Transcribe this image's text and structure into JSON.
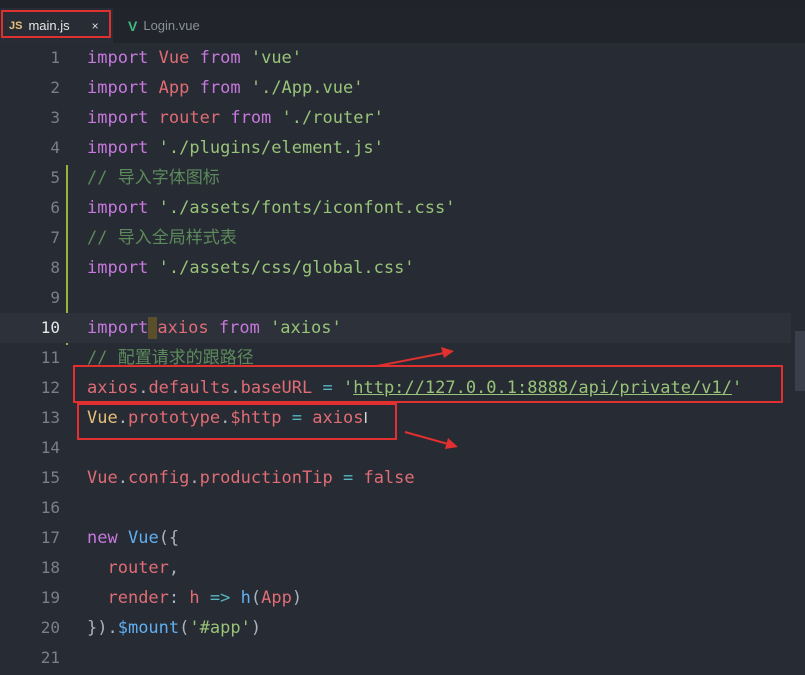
{
  "tabs": [
    {
      "icon": "JS",
      "label": "main.js",
      "close": "×",
      "active": true
    },
    {
      "icon": "V",
      "label": "Login.vue",
      "active": false
    }
  ],
  "lines": [
    {
      "n": "1",
      "tokens": [
        [
          "kw",
          "import"
        ],
        [
          "pl",
          " "
        ],
        [
          "id",
          "Vue"
        ],
        [
          "pl",
          " "
        ],
        [
          "kw",
          "from"
        ],
        [
          "pl",
          " "
        ],
        [
          "str",
          "'vue'"
        ]
      ]
    },
    {
      "n": "2",
      "tokens": [
        [
          "kw",
          "import"
        ],
        [
          "pl",
          " "
        ],
        [
          "id",
          "App"
        ],
        [
          "pl",
          " "
        ],
        [
          "kw",
          "from"
        ],
        [
          "pl",
          " "
        ],
        [
          "str",
          "'./App.vue'"
        ]
      ]
    },
    {
      "n": "3",
      "tokens": [
        [
          "kw",
          "import"
        ],
        [
          "pl",
          " "
        ],
        [
          "id",
          "router"
        ],
        [
          "pl",
          " "
        ],
        [
          "kw",
          "from"
        ],
        [
          "pl",
          " "
        ],
        [
          "str",
          "'./router'"
        ]
      ]
    },
    {
      "n": "4",
      "tokens": [
        [
          "kw",
          "import"
        ],
        [
          "pl",
          " "
        ],
        [
          "str",
          "'./plugins/element.js'"
        ]
      ]
    },
    {
      "n": "5",
      "tokens": [
        [
          "cm",
          "// 导入字体图标"
        ]
      ]
    },
    {
      "n": "6",
      "tokens": [
        [
          "kw",
          "import"
        ],
        [
          "pl",
          " "
        ],
        [
          "str",
          "'./assets/fonts/iconfont.css'"
        ]
      ]
    },
    {
      "n": "7",
      "tokens": [
        [
          "cm",
          "// 导入全局样式表"
        ]
      ]
    },
    {
      "n": "8",
      "tokens": [
        [
          "kw",
          "import"
        ],
        [
          "pl",
          " "
        ],
        [
          "str",
          "'./assets/css/global.css'"
        ]
      ]
    },
    {
      "n": "9",
      "tokens": []
    },
    {
      "n": "10",
      "tokens": [
        [
          "kw",
          "import"
        ],
        [
          "cursor",
          " "
        ],
        [
          "id",
          "axios"
        ],
        [
          "pl",
          " "
        ],
        [
          "kw",
          "from"
        ],
        [
          "pl",
          " "
        ],
        [
          "str",
          "'axios'"
        ]
      ]
    },
    {
      "n": "11",
      "tokens": [
        [
          "cm",
          "// 配置请求的跟路径"
        ]
      ]
    },
    {
      "n": "12",
      "tokens": [
        [
          "id",
          "axios"
        ],
        [
          "pl",
          "."
        ],
        [
          "id",
          "defaults"
        ],
        [
          "pl",
          "."
        ],
        [
          "id",
          "baseURL"
        ],
        [
          "pl",
          " "
        ],
        [
          "op",
          "="
        ],
        [
          "pl",
          " "
        ],
        [
          "str",
          "'"
        ],
        [
          "url",
          "http://127.0.0.1:8888/api/private/v1/"
        ],
        [
          "str",
          "'"
        ]
      ]
    },
    {
      "n": "13",
      "tokens": [
        [
          "prop",
          "Vue"
        ],
        [
          "pl",
          "."
        ],
        [
          "id",
          "prototype"
        ],
        [
          "pl",
          "."
        ],
        [
          "id",
          "$http"
        ],
        [
          "pl",
          " "
        ],
        [
          "op",
          "="
        ],
        [
          "pl",
          " "
        ],
        [
          "id",
          "axios"
        ],
        [
          "ibeam",
          "I"
        ]
      ]
    },
    {
      "n": "14",
      "tokens": []
    },
    {
      "n": "15",
      "tokens": [
        [
          "id",
          "Vue"
        ],
        [
          "pl",
          "."
        ],
        [
          "id",
          "config"
        ],
        [
          "pl",
          "."
        ],
        [
          "id",
          "productionTip"
        ],
        [
          "pl",
          " "
        ],
        [
          "op",
          "="
        ],
        [
          "pl",
          " "
        ],
        [
          "id",
          "false"
        ]
      ]
    },
    {
      "n": "16",
      "tokens": []
    },
    {
      "n": "17",
      "tokens": [
        [
          "kw",
          "new"
        ],
        [
          "pl",
          " "
        ],
        [
          "fn",
          "Vue"
        ],
        [
          "pl",
          "({"
        ]
      ]
    },
    {
      "n": "18",
      "tokens": [
        [
          "pl",
          "  "
        ],
        [
          "id",
          "router"
        ],
        [
          "pl",
          ","
        ]
      ]
    },
    {
      "n": "19",
      "tokens": [
        [
          "pl",
          "  "
        ],
        [
          "id",
          "render"
        ],
        [
          "pl",
          ": "
        ],
        [
          "id",
          "h"
        ],
        [
          "pl",
          " "
        ],
        [
          "op",
          "=>"
        ],
        [
          "pl",
          " "
        ],
        [
          "fn",
          "h"
        ],
        [
          "pl",
          "("
        ],
        [
          "id",
          "App"
        ],
        [
          "pl",
          ")"
        ]
      ]
    },
    {
      "n": "20",
      "tokens": [
        [
          "pl",
          "})."
        ],
        [
          "fn",
          "$mount"
        ],
        [
          "pl",
          "("
        ],
        [
          "str",
          "'#app'"
        ],
        [
          "pl",
          ")"
        ]
      ]
    },
    {
      "n": "21",
      "tokens": []
    }
  ],
  "current_line": "10",
  "colors": {
    "annotation": "#e03030",
    "background": "#272b33"
  }
}
